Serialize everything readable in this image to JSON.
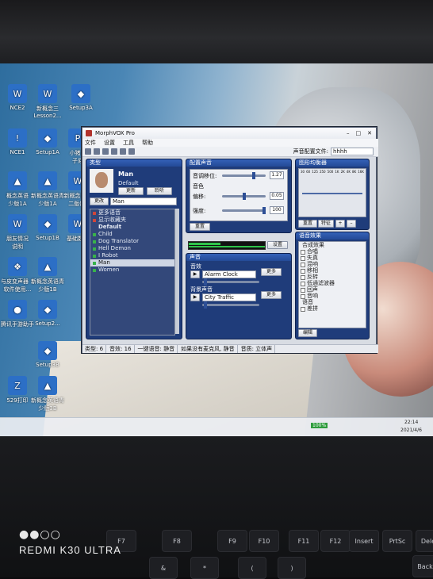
{
  "desktop": {
    "icons": [
      {
        "label": "NCE2",
        "glyph": "W",
        "kind": "word"
      },
      {
        "label": "新概念三\nLesson2...",
        "glyph": "W",
        "kind": "word"
      },
      {
        "label": "Setup3A",
        "glyph": "◆",
        "kind": "pkg"
      },
      {
        "label": "NCE1",
        "glyph": "!",
        "kind": "app"
      },
      {
        "label": "Setup1A",
        "glyph": "◆",
        "kind": "pkg"
      },
      {
        "label": "小猪…\n子尼",
        "glyph": "P",
        "kind": "pdf"
      },
      {
        "label": "概念英语\n少版1A",
        "glyph": "▲",
        "kind": "bot"
      },
      {
        "label": "新概念英语青\n少版1A",
        "glyph": "▲",
        "kind": "bot"
      },
      {
        "label": "新概念第…\n二版(…",
        "glyph": "W",
        "kind": "word"
      },
      {
        "label": "朋友情况\n说明",
        "glyph": "W",
        "kind": "word"
      },
      {
        "label": "Setup1B",
        "glyph": "◆",
        "kind": "pkg"
      },
      {
        "label": "基础数据",
        "glyph": "W",
        "kind": "word"
      },
      {
        "label": "与皮变声器（\n软件使用…",
        "glyph": "❖",
        "kind": "pkg"
      },
      {
        "label": "新概念英语青\n少版1B",
        "glyph": "▲",
        "kind": "bot"
      },
      {
        "label": "腾讯手游助手",
        "glyph": "●",
        "kind": "app"
      },
      {
        "label": "Setup2...",
        "glyph": "◆",
        "kind": "pkg"
      },
      {
        "label": "Setup3B",
        "glyph": "◆",
        "kind": "pkg"
      },
      {
        "label": "529打印",
        "glyph": "Z",
        "kind": "zip"
      },
      {
        "label": "新概念英语青\n少版3B",
        "glyph": "▲",
        "kind": "bot"
      }
    ]
  },
  "window": {
    "title": "MorphVOX Pro",
    "menu": [
      "文件",
      "设置",
      "工具",
      "帮助"
    ],
    "voice_file_label": "声音配置文件:",
    "voice_file_value": "hhhh"
  },
  "voices_panel": {
    "title": "类型",
    "current_name": "Man",
    "current_preset": "Default",
    "update_btn": "更新",
    "listen_btn": "聆听",
    "mode_btn": "更改",
    "mode_value": "Man",
    "links": [
      "更多语音",
      "显示收藏夹"
    ],
    "group": "Default",
    "items": [
      "Child",
      "Dog Translator",
      "Hell Demon",
      "I Robot",
      "Man",
      "Women"
    ],
    "selected": "Man"
  },
  "tweak_panel": {
    "title": "配置声音",
    "pitch_label": "音调移位:",
    "pitch_value": "1.27",
    "timbre_label": "音色",
    "shift_label": "偏移:",
    "shift_value": "0.05",
    "strength_label": "强度:",
    "strength_value": "100",
    "reset_btn": "重置",
    "settings_btn": "设置"
  },
  "sound_panel": {
    "title": "声音",
    "sfx_label": "音效",
    "sfx_value": "Alarm Clock",
    "more1": "更多",
    "bg_label": "背景声音",
    "bg_value": "City Traffic",
    "more2": "更多"
  },
  "eq_panel": {
    "title": "图形均衡器",
    "bands": [
      "30",
      "60",
      "125",
      "250",
      "500",
      "1K",
      "2K",
      "4K",
      "8K",
      "16K"
    ],
    "reset_btn": "重置",
    "feature_btn": "特征"
  },
  "effects_panel": {
    "title": "语音效果",
    "group1": "合成效果",
    "items": [
      "合唱",
      "失真",
      "混响",
      "移相",
      "反转",
      "低通滤波器",
      "回声",
      "音响"
    ],
    "group2": "语音",
    "sub": "差拼",
    "edit_btn": "编辑"
  },
  "status": [
    "类型: 6",
    "音效: 16",
    "一键语音: 静音",
    "如果没有麦克风, 静音",
    "音质: 立体声"
  ],
  "taskbar": {
    "time": "22:14",
    "date": "2021/4/6",
    "pct": "100%"
  },
  "phone": {
    "brand": "REDMI K30 ULTRA",
    "dots": "●●○○"
  },
  "keyboard": [
    "F7",
    "F8",
    "F9",
    "F10",
    "F11",
    "F12",
    "Insert",
    "PrtSc",
    "Dele",
    "&",
    "*",
    "(",
    ")",
    "Back"
  ]
}
